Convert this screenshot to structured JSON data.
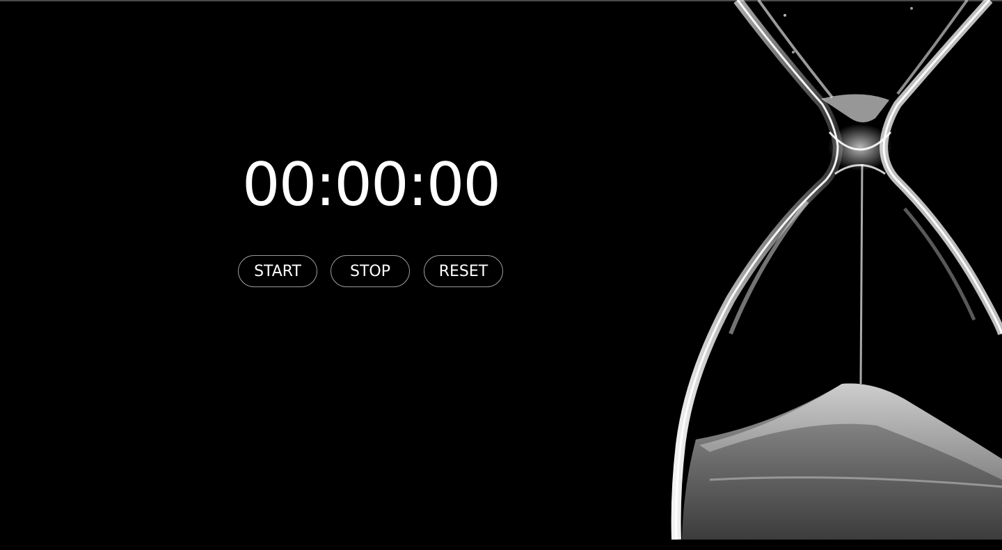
{
  "stopwatch": {
    "time": "00:00:00",
    "buttons": {
      "start": "START",
      "stop": "STOP",
      "reset": "RESET"
    }
  },
  "colors": {
    "background": "#000000",
    "text": "#ffffff",
    "button_border": "#9a9a9a"
  },
  "decoration": {
    "image_icon": "hourglass-icon"
  }
}
